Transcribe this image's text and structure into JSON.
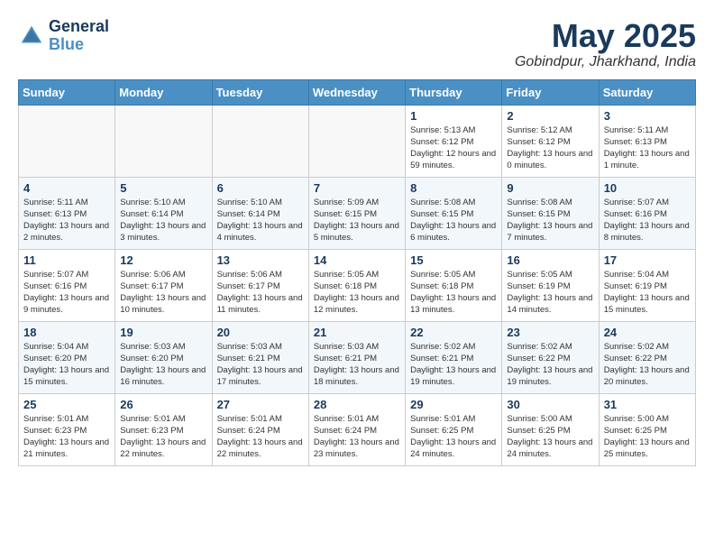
{
  "header": {
    "logo_line1": "General",
    "logo_line2": "Blue",
    "month": "May 2025",
    "location": "Gobindpur, Jharkhand, India"
  },
  "weekdays": [
    "Sunday",
    "Monday",
    "Tuesday",
    "Wednesday",
    "Thursday",
    "Friday",
    "Saturday"
  ],
  "weeks": [
    [
      {
        "day": "",
        "info": ""
      },
      {
        "day": "",
        "info": ""
      },
      {
        "day": "",
        "info": ""
      },
      {
        "day": "",
        "info": ""
      },
      {
        "day": "1",
        "info": "Sunrise: 5:13 AM\nSunset: 6:12 PM\nDaylight: 12 hours and 59 minutes."
      },
      {
        "day": "2",
        "info": "Sunrise: 5:12 AM\nSunset: 6:12 PM\nDaylight: 13 hours and 0 minutes."
      },
      {
        "day": "3",
        "info": "Sunrise: 5:11 AM\nSunset: 6:13 PM\nDaylight: 13 hours and 1 minute."
      }
    ],
    [
      {
        "day": "4",
        "info": "Sunrise: 5:11 AM\nSunset: 6:13 PM\nDaylight: 13 hours and 2 minutes."
      },
      {
        "day": "5",
        "info": "Sunrise: 5:10 AM\nSunset: 6:14 PM\nDaylight: 13 hours and 3 minutes."
      },
      {
        "day": "6",
        "info": "Sunrise: 5:10 AM\nSunset: 6:14 PM\nDaylight: 13 hours and 4 minutes."
      },
      {
        "day": "7",
        "info": "Sunrise: 5:09 AM\nSunset: 6:15 PM\nDaylight: 13 hours and 5 minutes."
      },
      {
        "day": "8",
        "info": "Sunrise: 5:08 AM\nSunset: 6:15 PM\nDaylight: 13 hours and 6 minutes."
      },
      {
        "day": "9",
        "info": "Sunrise: 5:08 AM\nSunset: 6:15 PM\nDaylight: 13 hours and 7 minutes."
      },
      {
        "day": "10",
        "info": "Sunrise: 5:07 AM\nSunset: 6:16 PM\nDaylight: 13 hours and 8 minutes."
      }
    ],
    [
      {
        "day": "11",
        "info": "Sunrise: 5:07 AM\nSunset: 6:16 PM\nDaylight: 13 hours and 9 minutes."
      },
      {
        "day": "12",
        "info": "Sunrise: 5:06 AM\nSunset: 6:17 PM\nDaylight: 13 hours and 10 minutes."
      },
      {
        "day": "13",
        "info": "Sunrise: 5:06 AM\nSunset: 6:17 PM\nDaylight: 13 hours and 11 minutes."
      },
      {
        "day": "14",
        "info": "Sunrise: 5:05 AM\nSunset: 6:18 PM\nDaylight: 13 hours and 12 minutes."
      },
      {
        "day": "15",
        "info": "Sunrise: 5:05 AM\nSunset: 6:18 PM\nDaylight: 13 hours and 13 minutes."
      },
      {
        "day": "16",
        "info": "Sunrise: 5:05 AM\nSunset: 6:19 PM\nDaylight: 13 hours and 14 minutes."
      },
      {
        "day": "17",
        "info": "Sunrise: 5:04 AM\nSunset: 6:19 PM\nDaylight: 13 hours and 15 minutes."
      }
    ],
    [
      {
        "day": "18",
        "info": "Sunrise: 5:04 AM\nSunset: 6:20 PM\nDaylight: 13 hours and 15 minutes."
      },
      {
        "day": "19",
        "info": "Sunrise: 5:03 AM\nSunset: 6:20 PM\nDaylight: 13 hours and 16 minutes."
      },
      {
        "day": "20",
        "info": "Sunrise: 5:03 AM\nSunset: 6:21 PM\nDaylight: 13 hours and 17 minutes."
      },
      {
        "day": "21",
        "info": "Sunrise: 5:03 AM\nSunset: 6:21 PM\nDaylight: 13 hours and 18 minutes."
      },
      {
        "day": "22",
        "info": "Sunrise: 5:02 AM\nSunset: 6:21 PM\nDaylight: 13 hours and 19 minutes."
      },
      {
        "day": "23",
        "info": "Sunrise: 5:02 AM\nSunset: 6:22 PM\nDaylight: 13 hours and 19 minutes."
      },
      {
        "day": "24",
        "info": "Sunrise: 5:02 AM\nSunset: 6:22 PM\nDaylight: 13 hours and 20 minutes."
      }
    ],
    [
      {
        "day": "25",
        "info": "Sunrise: 5:01 AM\nSunset: 6:23 PM\nDaylight: 13 hours and 21 minutes."
      },
      {
        "day": "26",
        "info": "Sunrise: 5:01 AM\nSunset: 6:23 PM\nDaylight: 13 hours and 22 minutes."
      },
      {
        "day": "27",
        "info": "Sunrise: 5:01 AM\nSunset: 6:24 PM\nDaylight: 13 hours and 22 minutes."
      },
      {
        "day": "28",
        "info": "Sunrise: 5:01 AM\nSunset: 6:24 PM\nDaylight: 13 hours and 23 minutes."
      },
      {
        "day": "29",
        "info": "Sunrise: 5:01 AM\nSunset: 6:25 PM\nDaylight: 13 hours and 24 minutes."
      },
      {
        "day": "30",
        "info": "Sunrise: 5:00 AM\nSunset: 6:25 PM\nDaylight: 13 hours and 24 minutes."
      },
      {
        "day": "31",
        "info": "Sunrise: 5:00 AM\nSunset: 6:25 PM\nDaylight: 13 hours and 25 minutes."
      }
    ]
  ]
}
